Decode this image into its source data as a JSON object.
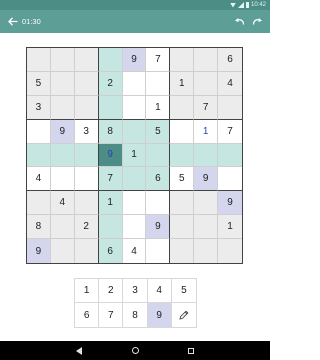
{
  "status_bar": {
    "time": "10:42",
    "icons": [
      "wifi-icon",
      "signal-icon",
      "battery-icon"
    ]
  },
  "toolbar": {
    "timer": "01:30",
    "icons": [
      "back-arrow-icon",
      "undo-icon",
      "redo-icon"
    ]
  },
  "colors": {
    "status_bar": "#4c8d86",
    "toolbar": "#5d9e97",
    "selected_cell": "#4c8d86",
    "highlight": "#c6e6e2",
    "shade": "#ececec",
    "conflict": "#d4d6ee",
    "user_digit": "#2a3fbf"
  },
  "board": {
    "selected": [
      4,
      3
    ],
    "rows": [
      [
        "",
        "",
        "",
        "",
        "9",
        "7",
        "",
        "",
        "6"
      ],
      [
        "5",
        "",
        "",
        "2",
        "",
        "",
        "1",
        "",
        "4"
      ],
      [
        "3",
        "",
        "",
        "",
        "",
        "1",
        "",
        "7",
        ""
      ],
      [
        "",
        "9",
        "3",
        "8",
        "",
        "5",
        "",
        "1",
        "7"
      ],
      [
        "",
        "",
        "",
        "9",
        "1",
        "",
        "",
        "",
        ""
      ],
      [
        "4",
        "",
        "",
        "7",
        "",
        "6",
        "5",
        "9",
        ""
      ],
      [
        "",
        "4",
        "",
        "1",
        "",
        "",
        "",
        "",
        "9"
      ],
      [
        "8",
        "",
        "2",
        "",
        "",
        "9",
        "",
        "",
        "1"
      ],
      [
        "9",
        "",
        "",
        "6",
        "4",
        "",
        "",
        "",
        ""
      ]
    ],
    "user_cells": [
      [
        3,
        7
      ],
      [
        4,
        3
      ]
    ],
    "conflict_cells": [
      [
        0,
        4
      ],
      [
        3,
        1
      ],
      [
        4,
        3
      ],
      [
        5,
        7
      ],
      [
        6,
        8
      ],
      [
        7,
        5
      ],
      [
        8,
        0
      ]
    ]
  },
  "numpad": {
    "keys": [
      "1",
      "2",
      "3",
      "4",
      "5",
      "6",
      "7",
      "8",
      "9"
    ],
    "active_key": "9",
    "extra_icon": "pencil-icon"
  },
  "nav_bar": {
    "icons": [
      "nav-back-icon",
      "nav-home-icon",
      "nav-recents-icon"
    ]
  }
}
